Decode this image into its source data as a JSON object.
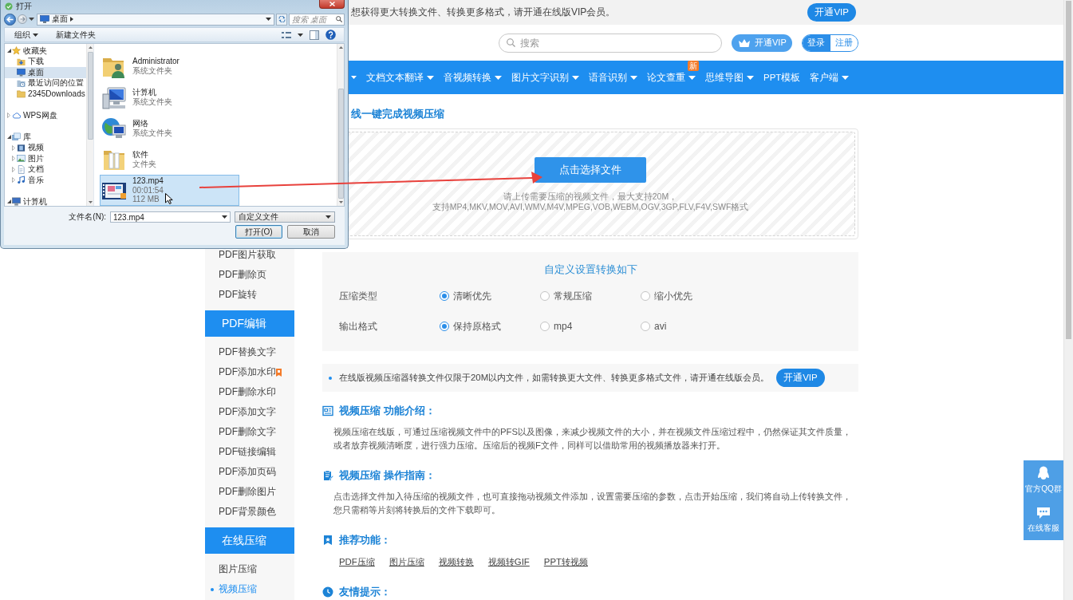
{
  "dialog": {
    "title": "打开",
    "address": "桌面",
    "search": {
      "placeholder": "搜索 桌面"
    },
    "toolbar": [
      {
        "label": "组织",
        "menu": true
      },
      {
        "label": "新建文件夹",
        "menu": false
      }
    ],
    "nav_pane": [
      {
        "kind": "favorites",
        "label": "收藏夹",
        "expanded": true,
        "selected": false,
        "children": [
          {
            "kind": "downloads",
            "label": "下载",
            "selected": false
          },
          {
            "kind": "desktop",
            "label": "桌面",
            "selected": true
          },
          {
            "kind": "recent",
            "label": "最近访问的位置",
            "selected": false
          },
          {
            "kind": "folder",
            "label": "2345Downloads",
            "selected": false
          }
        ]
      },
      {
        "kind": "cloud",
        "label": "WPS网盘",
        "expanded": false,
        "selected": false
      },
      {
        "kind": "library",
        "label": "库",
        "expanded": true,
        "selected": false,
        "children": [
          {
            "kind": "video",
            "label": "视频",
            "expanded": false,
            "selected": false
          },
          {
            "kind": "pictures",
            "label": "图片",
            "expanded": false,
            "selected": false
          },
          {
            "kind": "documents",
            "label": "文档",
            "expanded": false,
            "selected": false
          },
          {
            "kind": "music",
            "label": "音乐",
            "expanded": false,
            "selected": false
          }
        ]
      },
      {
        "kind": "computer",
        "label": "计算机",
        "expanded": true,
        "selected": false
      }
    ],
    "files": [
      {
        "kind": "user-folder",
        "name": "Administrator",
        "details": [
          "系统文件夹"
        ],
        "selected": false
      },
      {
        "kind": "computer",
        "name": "计算机",
        "details": [
          "系统文件夹"
        ],
        "selected": false
      },
      {
        "kind": "network",
        "name": "网络",
        "details": [
          "系统文件夹"
        ],
        "selected": false
      },
      {
        "kind": "folder",
        "name": "软件",
        "details": [
          "文件夹"
        ],
        "selected": false
      },
      {
        "kind": "video",
        "name": "123.mp4",
        "details": [
          "00:01:54",
          "112 MB"
        ],
        "selected": true
      }
    ],
    "file_name": {
      "label": "文件名(N):",
      "value": "123.mp4"
    },
    "file_type": "自定义文件",
    "buttons": [
      {
        "label": "打开(O)",
        "default": true
      },
      {
        "label": "取消",
        "default": false
      }
    ]
  },
  "notice_bar": {
    "text": "想获得更大转换文件、转换更多格式，请开通在线版VIP会员。",
    "button": "开通VIP"
  },
  "header": {
    "search": {
      "placeholder": "搜索"
    },
    "vip_button": "开通VIP",
    "login_button": "登录",
    "register_button": "注册"
  },
  "nav": [
    {
      "label": "文档文本翻译",
      "menu": true
    },
    {
      "label": "音视频转换",
      "menu": true
    },
    {
      "label": "图片文字识别",
      "menu": true
    },
    {
      "label": "语音识别",
      "menu": true
    },
    {
      "label": "论文查重",
      "menu": true,
      "badge": "新"
    },
    {
      "label": "思维导图",
      "menu": true
    },
    {
      "label": "PPT模板",
      "menu": false
    },
    {
      "label": "客户端",
      "menu": true
    }
  ],
  "sidebar": [
    {
      "kind": "item",
      "label": "PDF图片获取",
      "selected": false,
      "hot": false
    },
    {
      "kind": "item",
      "label": "PDF删除页",
      "selected": false,
      "hot": false
    },
    {
      "kind": "item",
      "label": "PDF旋转",
      "selected": false,
      "hot": false
    },
    {
      "kind": "header",
      "label": "PDF编辑"
    },
    {
      "kind": "item",
      "label": "PDF替换文字",
      "selected": false,
      "hot": false
    },
    {
      "kind": "item",
      "label": "PDF添加水印",
      "selected": false,
      "hot": true
    },
    {
      "kind": "item",
      "label": "PDF删除水印",
      "selected": false,
      "hot": false
    },
    {
      "kind": "item",
      "label": "PDF添加文字",
      "selected": false,
      "hot": false
    },
    {
      "kind": "item",
      "label": "PDF删除文字",
      "selected": false,
      "hot": false
    },
    {
      "kind": "item",
      "label": "PDF链接编辑",
      "selected": false,
      "hot": false
    },
    {
      "kind": "item",
      "label": "PDF添加页码",
      "selected": false,
      "hot": false
    },
    {
      "kind": "item",
      "label": "PDF删除图片",
      "selected": false,
      "hot": false
    },
    {
      "kind": "item",
      "label": "PDF背景颜色",
      "selected": false,
      "hot": false
    },
    {
      "kind": "header",
      "label": "在线压缩"
    },
    {
      "kind": "item",
      "label": "图片压缩",
      "selected": false,
      "hot": false
    },
    {
      "kind": "item",
      "label": "视频压缩",
      "selected": true,
      "hot": false
    }
  ],
  "main": {
    "title": "线一键完成视频压缩",
    "upload": {
      "button": "点击选择文件",
      "hints": [
        "请上传需要压缩的视频文件，最大支持20M，",
        "支持MP4,MKV,MOV,AVI,WMV,M4V,MPEG,VOB,WEBM,OGV,3GP,FLV,F4V,SWF格式"
      ]
    },
    "settings": {
      "title": "自定义设置转换如下",
      "rows": [
        {
          "label": "压缩类型",
          "options": [
            {
              "label": "清晰优先",
              "selected": true
            },
            {
              "label": "常规压缩",
              "selected": false
            },
            {
              "label": "缩小优先",
              "selected": false
            }
          ]
        },
        {
          "label": "输出格式",
          "options": [
            {
              "label": "保持原格式",
              "selected": true
            },
            {
              "label": "mp4",
              "selected": false
            },
            {
              "label": "avi",
              "selected": false
            }
          ]
        }
      ]
    },
    "notice": {
      "text": "在线版视频压缩器转换文件仅限于20M以内文件，如需转换更大文件、转换更多格式文件，请开通在线版会员。",
      "button": "开通VIP"
    },
    "sections": [
      {
        "kind": "intro",
        "title": "视频压缩 功能介绍：",
        "text": "视频压缩在线版，可通过压缩视频文件中的PFS以及图像，来减少视频文件的大小，并在视频文件压缩过程中，仍然保证其文件质量，或者放弃视频清晰度，进行强力压缩。压缩后的视频F文件，同样可以借助常用的视频播放器来打开。"
      },
      {
        "kind": "guide",
        "title": "视频压缩 操作指南：",
        "text": "点击选择文件加入待压缩的视频文件，也可直接拖动视频文件添加，设置需要压缩的参数，点击开始压缩，我们将自动上传转换文件，您只需稍等片刻将转换后的文件下载即可。"
      },
      {
        "kind": "recommend",
        "title": "推荐功能：",
        "links": [
          "PDF压缩",
          "图片压缩",
          "视频转换",
          "视频转GIF",
          "PPT转视频"
        ]
      },
      {
        "kind": "tips",
        "title": "友情提示："
      }
    ]
  },
  "side_widget": [
    {
      "kind": "qq",
      "label": "官方QQ群"
    },
    {
      "kind": "chat",
      "label": "在线客服"
    }
  ]
}
